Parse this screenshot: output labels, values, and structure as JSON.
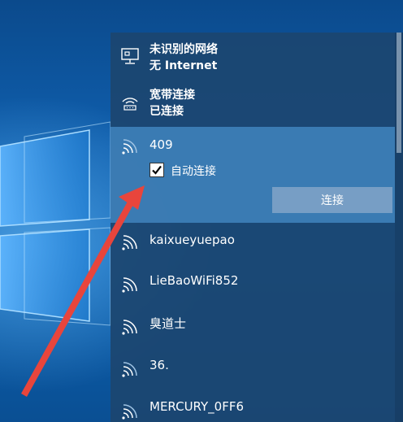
{
  "networks": {
    "unidentified": {
      "title": "未识别的网络",
      "status": "无 Internet",
      "icon": "wired-monitor-icon"
    },
    "broadband": {
      "title": "宽带连接",
      "status": "已连接",
      "icon": "dialup-icon"
    },
    "selected": {
      "name": "409",
      "auto_connect_label": "自动连接",
      "auto_connect_checked": true,
      "connect_label": "连接",
      "icon": "wifi-icon"
    },
    "list": [
      {
        "name": "kaixueyuepao",
        "icon": "wifi-icon"
      },
      {
        "name": "LieBaoWiFi852",
        "icon": "wifi-icon"
      },
      {
        "name": "臭道士",
        "icon": "wifi-icon"
      },
      {
        "name": "36.",
        "icon": "wifi-icon"
      },
      {
        "name": "MERCURY_0FF6",
        "icon": "wifi-icon"
      }
    ]
  },
  "annotation": {
    "color": "#e8453c"
  },
  "colors": {
    "flyout_bg": "#1c4670",
    "selected_bg": "#468cc8",
    "button_bg": "#82a5c8"
  }
}
